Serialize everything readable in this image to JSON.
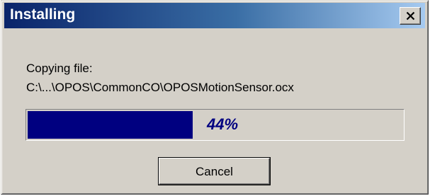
{
  "window": {
    "title": "Installing",
    "close_icon": "close-x-icon"
  },
  "message": {
    "line1": "Copying file:",
    "line2": "C:\\...\\OPOS\\CommonCO\\OPOSMotionSensor.ocx"
  },
  "progress": {
    "percent": 44,
    "label": "44%",
    "fill_color": "#000080"
  },
  "buttons": {
    "cancel_label": "Cancel"
  },
  "colors": {
    "titlebar_start": "#0a246a",
    "titlebar_end": "#a6caf0",
    "dialog_bg": "#d4d0c8"
  }
}
